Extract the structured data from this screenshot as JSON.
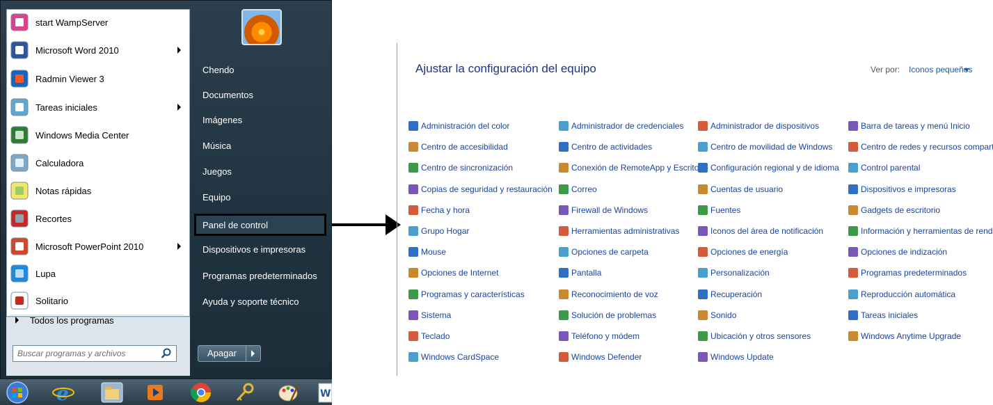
{
  "start_menu": {
    "programs": [
      {
        "label": "start WampServer",
        "icon": "wampserver-icon",
        "has_submenu": false
      },
      {
        "label": "Microsoft Word 2010",
        "icon": "word-icon",
        "has_submenu": true
      },
      {
        "label": "Radmin Viewer 3",
        "icon": "radmin-icon",
        "has_submenu": false
      },
      {
        "label": "Tareas iniciales",
        "icon": "getting-started-icon",
        "has_submenu": true
      },
      {
        "label": "Windows Media Center",
        "icon": "media-center-icon",
        "has_submenu": false
      },
      {
        "label": "Calculadora",
        "icon": "calculator-icon",
        "has_submenu": false
      },
      {
        "label": "Notas rápidas",
        "icon": "sticky-notes-icon",
        "has_submenu": false
      },
      {
        "label": "Recortes",
        "icon": "snipping-tool-icon",
        "has_submenu": false
      },
      {
        "label": "Microsoft PowerPoint 2010",
        "icon": "powerpoint-icon",
        "has_submenu": true
      },
      {
        "label": "Lupa",
        "icon": "magnifier-icon",
        "has_submenu": false
      },
      {
        "label": "Solitario",
        "icon": "solitaire-icon",
        "has_submenu": false
      }
    ],
    "all_programs_label": "Todos los programas",
    "search_placeholder": "Buscar programas y archivos",
    "right_items": [
      {
        "label": "Chendo",
        "highlighted": false
      },
      {
        "label": "Documentos",
        "highlighted": false
      },
      {
        "label": "Imágenes",
        "highlighted": false
      },
      {
        "label": "Música",
        "highlighted": false
      },
      {
        "label": "Juegos",
        "highlighted": false
      },
      {
        "label": "Equipo",
        "highlighted": false
      },
      {
        "label": "Panel de control",
        "highlighted": true
      },
      {
        "label": "Dispositivos e impresoras",
        "highlighted": false
      },
      {
        "label": "Programas predeterminados",
        "highlighted": false
      },
      {
        "label": "Ayuda y soporte técnico",
        "highlighted": false
      }
    ],
    "shutdown_label": "Apagar"
  },
  "taskbar": {
    "icons": [
      "start-orb-icon",
      "internet-explorer-icon",
      "file-explorer-icon",
      "media-player-icon",
      "chrome-icon",
      "key-icon",
      "paint-icon",
      "word-icon"
    ]
  },
  "control_panel": {
    "title": "Ajustar la configuración del equipo",
    "view_by_label": "Ver por:",
    "view_by_value": "Iconos pequeños",
    "columns": [
      [
        "Administración del color",
        "Centro de accesibilidad",
        "Centro de sincronización",
        "Copias de seguridad y restauración",
        "Fecha y hora",
        "Grupo Hogar",
        "Mouse",
        "Opciones de Internet",
        "Programas y características",
        "Sistema",
        "Teclado",
        "Windows CardSpace"
      ],
      [
        "Administrador de credenciales",
        "Centro de actividades",
        "Conexión de RemoteApp y Escritorio",
        "Correo",
        "Firewall de Windows",
        "Herramientas administrativas",
        "Opciones de carpeta",
        "Pantalla",
        "Reconocimiento de voz",
        "Solución de problemas",
        "Teléfono y módem",
        "Windows Defender"
      ],
      [
        "Administrador de dispositivos",
        "Centro de movilidad de Windows",
        "Configuración regional y de idioma",
        "Cuentas de usuario",
        "Fuentes",
        "Iconos del área de notificación",
        "Opciones de energía",
        "Personalización",
        "Recuperación",
        "Sonido",
        "Ubicación y otros sensores",
        "Windows Update"
      ],
      [
        "Barra de tareas y menú Inicio",
        "Centro de redes y recursos comparti...",
        "Control parental",
        "Dispositivos e impresoras",
        "Gadgets de escritorio",
        "Información y herramientas de rendi...",
        "Opciones de indización",
        "Programas predeterminados",
        "Reproducción automática",
        "Tareas iniciales",
        "Windows Anytime Upgrade"
      ]
    ]
  }
}
